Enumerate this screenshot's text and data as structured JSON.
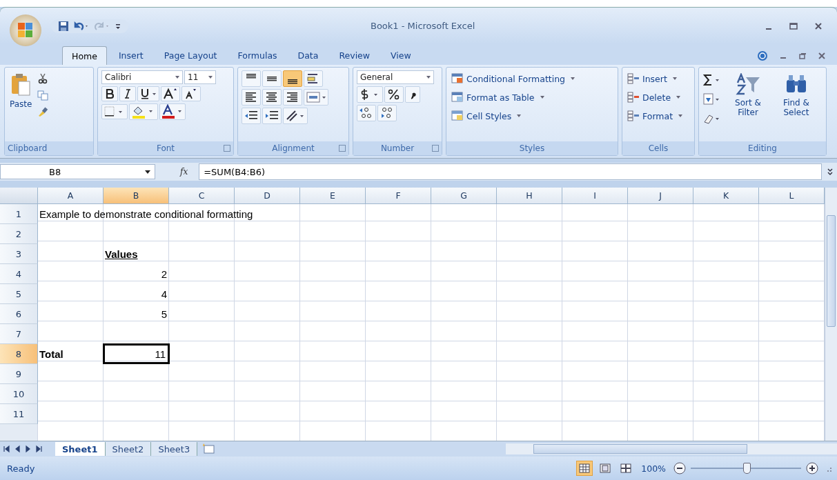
{
  "window": {
    "title": "Book1 - Microsoft Excel"
  },
  "tabs": [
    {
      "label": "Home",
      "selected": true
    },
    {
      "label": "Insert",
      "selected": false
    },
    {
      "label": "Page Layout",
      "selected": false
    },
    {
      "label": "Formulas",
      "selected": false
    },
    {
      "label": "Data",
      "selected": false
    },
    {
      "label": "Review",
      "selected": false
    },
    {
      "label": "View",
      "selected": false
    }
  ],
  "ribbon": {
    "clipboard": {
      "label": "Clipboard",
      "paste": "Paste"
    },
    "font": {
      "label": "Font",
      "family": "Calibri",
      "size": "11"
    },
    "alignment": {
      "label": "Alignment",
      "vertical": [
        {
          "selected": false
        },
        {
          "selected": false
        },
        {
          "selected": true
        }
      ]
    },
    "number": {
      "label": "Number",
      "format": "General"
    },
    "styles": {
      "label": "Styles",
      "items": [
        "Conditional Formatting",
        "Format as Table",
        "Cell Styles"
      ]
    },
    "cells": {
      "label": "Cells",
      "items": [
        "Insert",
        "Delete",
        "Format"
      ]
    },
    "editing": {
      "label": "Editing",
      "items": [
        "Sort & Filter",
        "Find & Select"
      ]
    }
  },
  "formula_bar": {
    "name_box": "B8",
    "fx": "fx",
    "formula": "=SUM(B4:B6)"
  },
  "columns": [
    {
      "label": "A",
      "selected": false
    },
    {
      "label": "B",
      "selected": true
    },
    {
      "label": "C",
      "selected": false
    },
    {
      "label": "D",
      "selected": false
    },
    {
      "label": "E",
      "selected": false
    },
    {
      "label": "F",
      "selected": false
    },
    {
      "label": "G",
      "selected": false
    },
    {
      "label": "H",
      "selected": false
    },
    {
      "label": "I",
      "selected": false
    },
    {
      "label": "J",
      "selected": false
    },
    {
      "label": "K",
      "selected": false
    },
    {
      "label": "L",
      "selected": false
    }
  ],
  "rows": [
    {
      "number": "1",
      "selected": false,
      "cells": [
        {
          "text": "Example to demonstrate conditional formatting",
          "kind": "text",
          "bold": false,
          "underline": false,
          "selected": false
        }
      ]
    },
    {
      "number": "2",
      "selected": false,
      "cells": []
    },
    {
      "number": "3",
      "selected": false,
      "cells": [
        null,
        {
          "text": "Values",
          "kind": "text",
          "bold": true,
          "underline": true,
          "selected": false
        }
      ]
    },
    {
      "number": "4",
      "selected": false,
      "cells": [
        null,
        {
          "text": "2",
          "kind": "number",
          "bold": false,
          "underline": false,
          "selected": false
        }
      ]
    },
    {
      "number": "5",
      "selected": false,
      "cells": [
        null,
        {
          "text": "4",
          "kind": "number",
          "bold": false,
          "underline": false,
          "selected": false
        }
      ]
    },
    {
      "number": "6",
      "selected": false,
      "cells": [
        null,
        {
          "text": "5",
          "kind": "number",
          "bold": false,
          "underline": false,
          "selected": false
        }
      ]
    },
    {
      "number": "7",
      "selected": false,
      "cells": []
    },
    {
      "number": "8",
      "selected": true,
      "cells": [
        {
          "text": "Total",
          "kind": "text",
          "bold": true,
          "underline": false,
          "selected": false
        },
        {
          "text": "11",
          "kind": "number",
          "bold": false,
          "underline": false,
          "selected": true
        }
      ]
    },
    {
      "number": "9",
      "selected": false,
      "cells": []
    },
    {
      "number": "10",
      "selected": false,
      "cells": []
    },
    {
      "number": "11",
      "selected": false,
      "cells": []
    }
  ],
  "sheet_tabs": [
    {
      "label": "Sheet1",
      "selected": true
    },
    {
      "label": "Sheet2",
      "selected": false
    },
    {
      "label": "Sheet3",
      "selected": false
    }
  ],
  "status_bar": {
    "text": "Ready",
    "views": [
      {
        "selected": true
      },
      {
        "selected": false
      },
      {
        "selected": false
      }
    ],
    "zoom": "100%",
    "zoom_slider": {
      "level": 0.5
    }
  }
}
